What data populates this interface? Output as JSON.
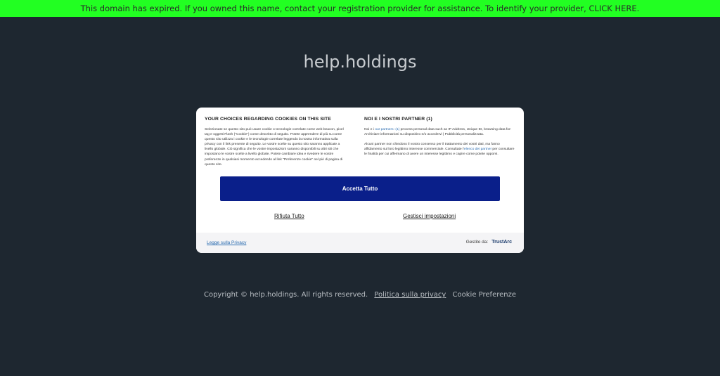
{
  "banner": {
    "text": "This domain has expired. If you owned this name, contact your registration provider for assistance. To identify your provider, CLICK HERE."
  },
  "site": {
    "title": "help.holdings"
  },
  "cookie_modal": {
    "left_heading": "YOUR CHOICES REGARDING COOKIES ON THIS SITE",
    "left_body": "Selezionate se questo sito può usare cookie o tecnologie correlate come web beacon, pixel tag e oggetti Flash (\"Cookie\") come descritto di seguito. Potete apprendere di più su come questo sito utilizza i cookie e le tecnologie correlate leggendo la nostra informativa sulla privacy con il link presente di seguito. Le vostre scelte su questo sito saranno applicate a livello globale. Ciò significa che le vostre impostazioni saranno disponibili su altri siti che impostano le vostre scelte a livello globale. Potete cambiare idea e rivedere le vostre preferenze in qualsiasi momento accedendo al link \"Preferenze cookie\" nel piè di pagina di questo sito.",
    "right_heading": "NOI E I NOSTRI PARTNER (1)",
    "right_p1_pre": "Noi e i ",
    "right_p1_link": "our partners: (1)",
    "right_p1_post": " process personal data such as IP Address, Unique ID, browsing data for: Archiviare informazioni su dispositivo e/o accedervi | Pubblicità personalizzata.",
    "right_p2_pre": "Alcuni partner non chiedono il vostro consenso per il trattamento dei vostri dati, ma fanno affidamento sul loro legittimo interesse commerciale. Consultate l'",
    "right_p2_link": "elenco dei partner",
    "right_p2_post": " per consultare le finalità per cui affermano di avere un interesse legittimo e capire come potete opporvi.",
    "accept_label": "Accetta Tutto",
    "reject_label": "Rifiuta Tutto",
    "manage_label": "Gestisci impostazioni",
    "privacy_link": "Legge sulla Privacy",
    "managed_by_label": "Gestito da:",
    "managed_by_brand": "TrustArc"
  },
  "footer": {
    "copyright": "Copyright © help.holdings.  All rights reserved.",
    "privacy_link": "Politica sulla privacy",
    "cookie_prefs": "Cookie Preferenze"
  },
  "colors": {
    "banner_bg": "#22ff22",
    "page_bg": "#1e2730",
    "accept_button": "#0a1f8a",
    "link": "#2b6cb0"
  }
}
